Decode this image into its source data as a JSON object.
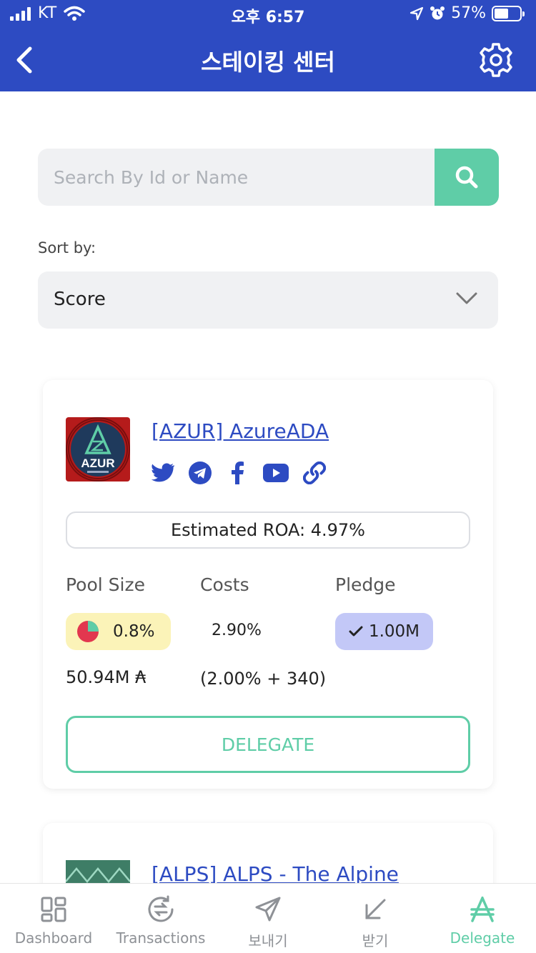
{
  "status_bar": {
    "carrier": "KT",
    "time": "오후 6:57",
    "battery_percent": "57%",
    "battery_level": 0.57
  },
  "header": {
    "title": "스테이킹 센터",
    "back_icon": "chevron-left-icon",
    "settings_icon": "gear-icon"
  },
  "search": {
    "placeholder": "Search By Id or Name",
    "button_icon": "search-icon"
  },
  "sort": {
    "label": "Sort by:",
    "value": "Score"
  },
  "pools": [
    {
      "name": "[AZUR] AzureADA",
      "logo_text": "AZUR",
      "socials": [
        "twitter-icon",
        "telegram-icon",
        "facebook-icon",
        "youtube-icon",
        "link-icon"
      ],
      "roa": "Estimated ROA: 4.97%",
      "pool_size_label": "Pool Size",
      "costs_label": "Costs",
      "pledge_label": "Pledge",
      "pool_size_percent": "0.8%",
      "costs": "2.90%",
      "pledge": "1.00M",
      "pool_size_ada": "50.94M ₳",
      "costs_detail": "(2.00% + 340)",
      "delegate_label": "DELEGATE"
    },
    {
      "name": "[ALPS] ALPS - The Alpine"
    }
  ],
  "tabs": [
    {
      "label": "Dashboard",
      "icon": "dashboard-icon"
    },
    {
      "label": "Transactions",
      "icon": "transactions-icon"
    },
    {
      "label": "보내기",
      "icon": "send-icon"
    },
    {
      "label": "받기",
      "icon": "receive-icon"
    },
    {
      "label": "Delegate",
      "icon": "ada-icon",
      "active": true
    }
  ],
  "colors": {
    "brand_blue": "#2d4bc2",
    "accent_green": "#5fcda7",
    "pool_size_bg": "#fbf3b8",
    "pledge_bg": "#c3c8f7"
  }
}
